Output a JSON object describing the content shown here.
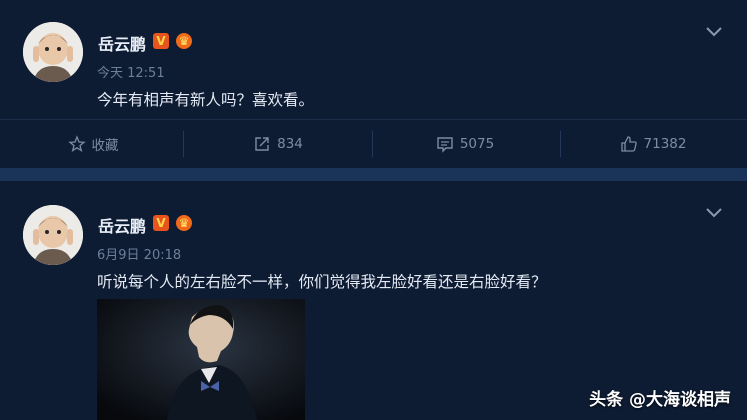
{
  "posts": [
    {
      "author": "岳云鹏",
      "badges": {
        "verified": "V",
        "crown": "♛"
      },
      "time": "今天 12:51",
      "text": "今年有相声有新人吗？喜欢看。",
      "actions": {
        "favorite_label": "收藏",
        "repost_count": "834",
        "comment_count": "5075",
        "like_count": "71382"
      }
    },
    {
      "author": "岳云鹏",
      "badges": {
        "verified": "V",
        "crown": "♛"
      },
      "time": "6月9日 20:18",
      "text": "听说每个人的左右脸不一样，你们觉得我左脸好看还是右脸好看？"
    }
  ],
  "watermark": "头条 @大海谈相声",
  "colors": {
    "background": "#0d1b33",
    "separator": "#1a3358",
    "muted_text": "#7d8ba3",
    "badge_orange": "#e8541e"
  },
  "icons": [
    "chevron-down-icon",
    "star-icon",
    "share-icon",
    "comment-icon",
    "thumbs-up-icon"
  ]
}
